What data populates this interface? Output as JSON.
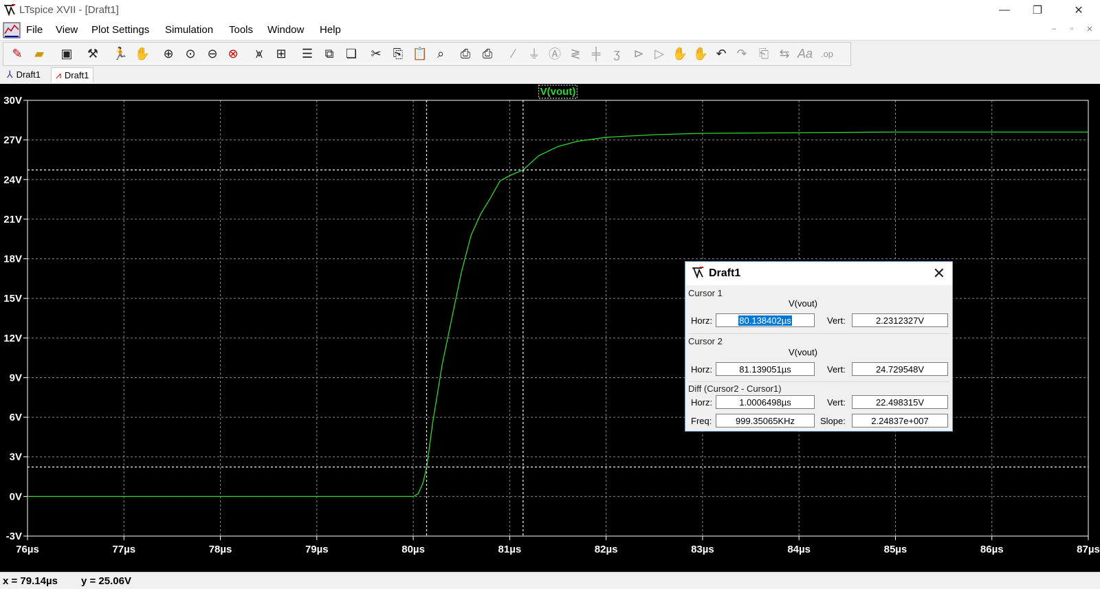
{
  "window": {
    "title": "LTspice XVII - [Draft1]",
    "minimize": "—",
    "maximize": "❐",
    "close": "✕"
  },
  "menu": [
    "File",
    "View",
    "Plot Settings",
    "Simulation",
    "Tools",
    "Window",
    "Help"
  ],
  "mdi_controls": [
    "–",
    "▫",
    "✕"
  ],
  "toolbar_icons": [
    "new-schematic-icon",
    "open-icon",
    "save-icon",
    "control-panel-icon",
    "run-icon",
    "halt-icon",
    "zoom-in-icon",
    "zoom-pan-icon",
    "zoom-out-icon",
    "zoom-cancel-icon",
    "autorange-icon",
    "plot-area-icon",
    "tile-horizontal-icon",
    "tile-vertical-icon",
    "cascade-icon",
    "cut-icon",
    "copy-icon",
    "paste-icon",
    "find-icon",
    "print-setup-icon",
    "print-icon",
    "wire-icon",
    "ground-icon",
    "label-icon",
    "resistor-icon",
    "capacitor-icon",
    "inductor-icon",
    "diode-icon",
    "component-icon",
    "move-icon",
    "drag-icon",
    "undo-icon",
    "redo-icon",
    "rotate-icon",
    "mirror-icon",
    "text-icon",
    "spice-directive-icon"
  ],
  "tabs": [
    {
      "label": "Draft1",
      "icon": "schematic-icon"
    },
    {
      "label": "Draft1",
      "icon": "waveform-icon"
    }
  ],
  "colors": {
    "trace": "#2fd92f",
    "grid": "#8a8a8a",
    "axis": "#ffffff",
    "background": "#000000"
  },
  "status": {
    "x": "x = 79.14µs",
    "y": "y = 25.06V"
  },
  "dialog": {
    "title": "Draft1",
    "close": "✕",
    "cursor1": {
      "label": "Cursor 1",
      "trace": "V(vout)",
      "horz_label": "Horz:",
      "horz": "80.138402µs",
      "vert_label": "Vert:",
      "vert": "2.2312327V"
    },
    "cursor2": {
      "label": "Cursor 2",
      "trace": "V(vout)",
      "horz_label": "Horz:",
      "horz": "81.139051µs",
      "vert_label": "Vert:",
      "vert": "24.729548V"
    },
    "diff": {
      "label": "Diff (Cursor2 - Cursor1)",
      "horz_label": "Horz:",
      "horz": "1.0006498µs",
      "vert_label": "Vert:",
      "vert": "22.498315V",
      "freq_label": "Freq:",
      "freq": "999.35065KHz",
      "slope_label": "Slope:",
      "slope": "2.24837e+007"
    }
  },
  "chart_data": {
    "type": "line",
    "series": [
      {
        "name": "V(vout)",
        "x": [
          76,
          77,
          78,
          79,
          80,
          80.05,
          80.1,
          80.14,
          80.2,
          80.3,
          80.4,
          80.5,
          80.6,
          80.7,
          80.8,
          80.9,
          81.0,
          81.14,
          81.3,
          81.5,
          81.7,
          82.0,
          82.5,
          83.0,
          84.0,
          85.0,
          86.0,
          87.0
        ],
        "values": [
          0,
          0,
          0,
          0,
          0,
          0.2,
          1.0,
          2.23,
          5.5,
          10.0,
          13.5,
          17.0,
          19.8,
          21.4,
          22.6,
          23.9,
          24.3,
          24.73,
          25.8,
          26.5,
          26.9,
          27.2,
          27.4,
          27.5,
          27.55,
          27.6,
          27.6,
          27.6
        ]
      }
    ],
    "xlim": [
      76,
      87
    ],
    "ylim": [
      -3,
      30
    ],
    "x_ticks": [
      "76µs",
      "77µs",
      "78µs",
      "79µs",
      "80µs",
      "81µs",
      "82µs",
      "83µs",
      "84µs",
      "85µs",
      "86µs",
      "87µs"
    ],
    "y_ticks": [
      "-3V",
      "0V",
      "3V",
      "6V",
      "9V",
      "12V",
      "15V",
      "18V",
      "21V",
      "24V",
      "27V",
      "30V"
    ],
    "cursors": [
      {
        "x": 80.138402,
        "y": 2.2312327
      },
      {
        "x": 81.139051,
        "y": 24.729548
      }
    ],
    "grid": true
  }
}
